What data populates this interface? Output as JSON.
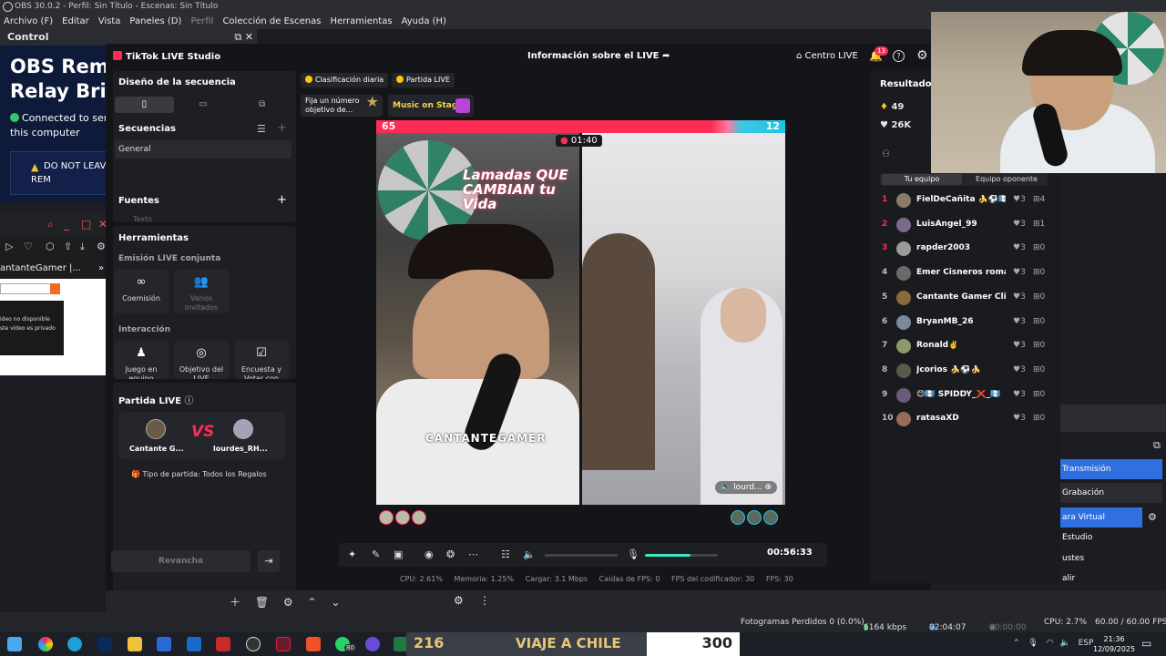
{
  "obs": {
    "title": "OBS 30.0.2 - Perfil: Sin Título - Escenas: Sin Título",
    "menu": [
      "Archivo (F)",
      "Editar",
      "Vista",
      "Paneles (D)",
      "Perfil",
      "Colección de Escenas",
      "Herramientas",
      "Ayuda (H)"
    ],
    "control_dock": "Control",
    "relay_title_1": "OBS Remo",
    "relay_title_2": "Relay Bridg",
    "relay_status": "Connected to serve this computer",
    "relay_warn": "DO NOT LEAV THE REM",
    "browser_channel": "antanteGamer |...",
    "video_unavailable_1": "ideo no disponible",
    "video_unavailable_2": "ste vídeo es privado",
    "status": {
      "dropped": "Fotogramas Perdidos 0 (0.0%)",
      "kbps": "6164 kbps",
      "live_time": "02:04:07",
      "rec_time": "00:00:00",
      "cpu": "CPU: 2.7%",
      "fps": "60.00 / 60.00 FPS"
    },
    "right_buttons": {
      "stream": "Transmisión",
      "record": "Grabación",
      "virtual_cam": "ara Virtual",
      "studio": "Estudio",
      "settings": "ustes",
      "exit": "alir"
    }
  },
  "tiktok": {
    "brand": "TikTok LIVE Studio",
    "live_info": "Información sobre el LIVE",
    "centro": "Centro LIVE",
    "notif_count": "13",
    "sequence_design": "Diseño de la secuencia",
    "sequences": "Secuencias",
    "sequence_item": "General",
    "sources": "Fuentes",
    "sources_partial": "Texto",
    "tools": "Herramientas",
    "joint_live": "Emisión LIVE conjunta",
    "cohost": "Coemisión",
    "multi_guest": "Varios invitados",
    "interaction": "Interacción",
    "game": "Juego en equipo",
    "live_goal": "Objetivo del LIVE",
    "poll": "Encuesta y Votar con",
    "party_title": "Partida LIVE",
    "player_left": "Cantante G...",
    "player_right": "lourdes_RH...",
    "vs": "VS",
    "party_type": "Tipo de partida: Todos los Regalos",
    "rematch": "Revancha",
    "chip_daily": "Clasificación diaria",
    "chip_party": "Partida LIVE",
    "pin_card": "Fija un número objetivo de...",
    "music_card": "Music on Stage",
    "score_left": "65",
    "score_right": "12",
    "timer": "01:40",
    "neon_sign": "Lamadas QUE CAMBIAN tu Vida",
    "watermark": "CANTANTEGAMER",
    "opponent_tag": "lourd...",
    "elapsed": "00:56:33",
    "stats": {
      "cpu": "CPU: 2.61%",
      "memory": "Memoria: 1.25%",
      "upload": "Cargar: 3.1 Mbps",
      "fps_drops": "Caídas de FPS: 0",
      "encoder_fps": "FPS del codificador: 30",
      "fps": "FPS: 30"
    },
    "results_title": "Resultados d",
    "results_val1": "49",
    "results_val2": "26K",
    "team_tabs": [
      "Tu equipo",
      "Equipo oponente"
    ],
    "ranking": [
      {
        "rank": "1",
        "name": "FielDeCañita 🍌⚽️🇬🇹❄️",
        "likes": "3",
        "gifts": "4"
      },
      {
        "rank": "2",
        "name": "LuisAngel_99",
        "likes": "3",
        "gifts": "1"
      },
      {
        "rank": "3",
        "name": "rapder2003",
        "likes": "3",
        "gifts": "0"
      },
      {
        "rank": "4",
        "name": "Emer Cisneros romani",
        "likes": "3",
        "gifts": "0"
      },
      {
        "rank": "5",
        "name": "Cantante Gamer Clips ...",
        "likes": "3",
        "gifts": "0"
      },
      {
        "rank": "6",
        "name": "BryanMB_26",
        "likes": "3",
        "gifts": "0"
      },
      {
        "rank": "7",
        "name": "Ronald✌️",
        "likes": "3",
        "gifts": "0"
      },
      {
        "rank": "8",
        "name": "Jcorios 🍌⚽️🍌",
        "likes": "3",
        "gifts": "0"
      },
      {
        "rank": "9",
        "name": "😊🇬🇹 SPIDDY_❌_🇬🇹",
        "likes": "3",
        "gifts": "0"
      },
      {
        "rank": "10",
        "name": "ratasaXD",
        "likes": "3",
        "gifts": "0"
      }
    ]
  },
  "taskbar": {
    "whatsapp_badge": "80",
    "goal_left": "216",
    "goal_title": "VIAJE A CHILE",
    "goal_right": "300",
    "goal_progress": 0.72,
    "lang": "ESP",
    "time": "21:36",
    "date": "12/09/2025"
  }
}
